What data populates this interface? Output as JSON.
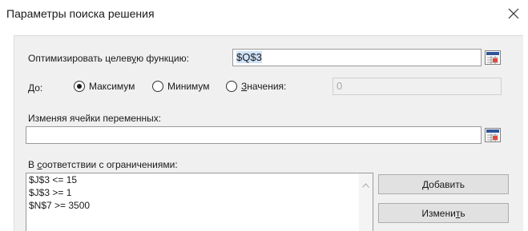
{
  "window": {
    "title": "Параметры поиска решения",
    "close_icon": "close-icon"
  },
  "objective": {
    "label_pre": "Оптимизировать целев",
    "label_u": "у",
    "label_post": "ю функцию:",
    "value": "$Q$3"
  },
  "to": {
    "label": "До:",
    "options": {
      "max": {
        "label": "Максимум",
        "selected": true
      },
      "min": {
        "label": "Минимум",
        "selected": false
      },
      "value": {
        "label_u": "З",
        "label_post": "начения:",
        "selected": false
      }
    },
    "value_field": "0"
  },
  "variables": {
    "label": "Изменяя ячейки переменных:",
    "value": ""
  },
  "constraints": {
    "label_pre": "В ",
    "label_u": "с",
    "label_post": "оответствии с ограничениями:",
    "items": [
      "$J$3 <= 15",
      "$J$3 >= 1",
      "$N$7 >= 3500"
    ]
  },
  "buttons": {
    "add": {
      "pre": "",
      "u": "Д",
      "post": "обавить"
    },
    "change": {
      "pre": "Измени",
      "u": "т",
      "post": "ь"
    }
  },
  "colors": {
    "panel_bg": "#f0f0f0",
    "selection": "#cfe3f7",
    "button_bg": "#e1e1e1"
  }
}
